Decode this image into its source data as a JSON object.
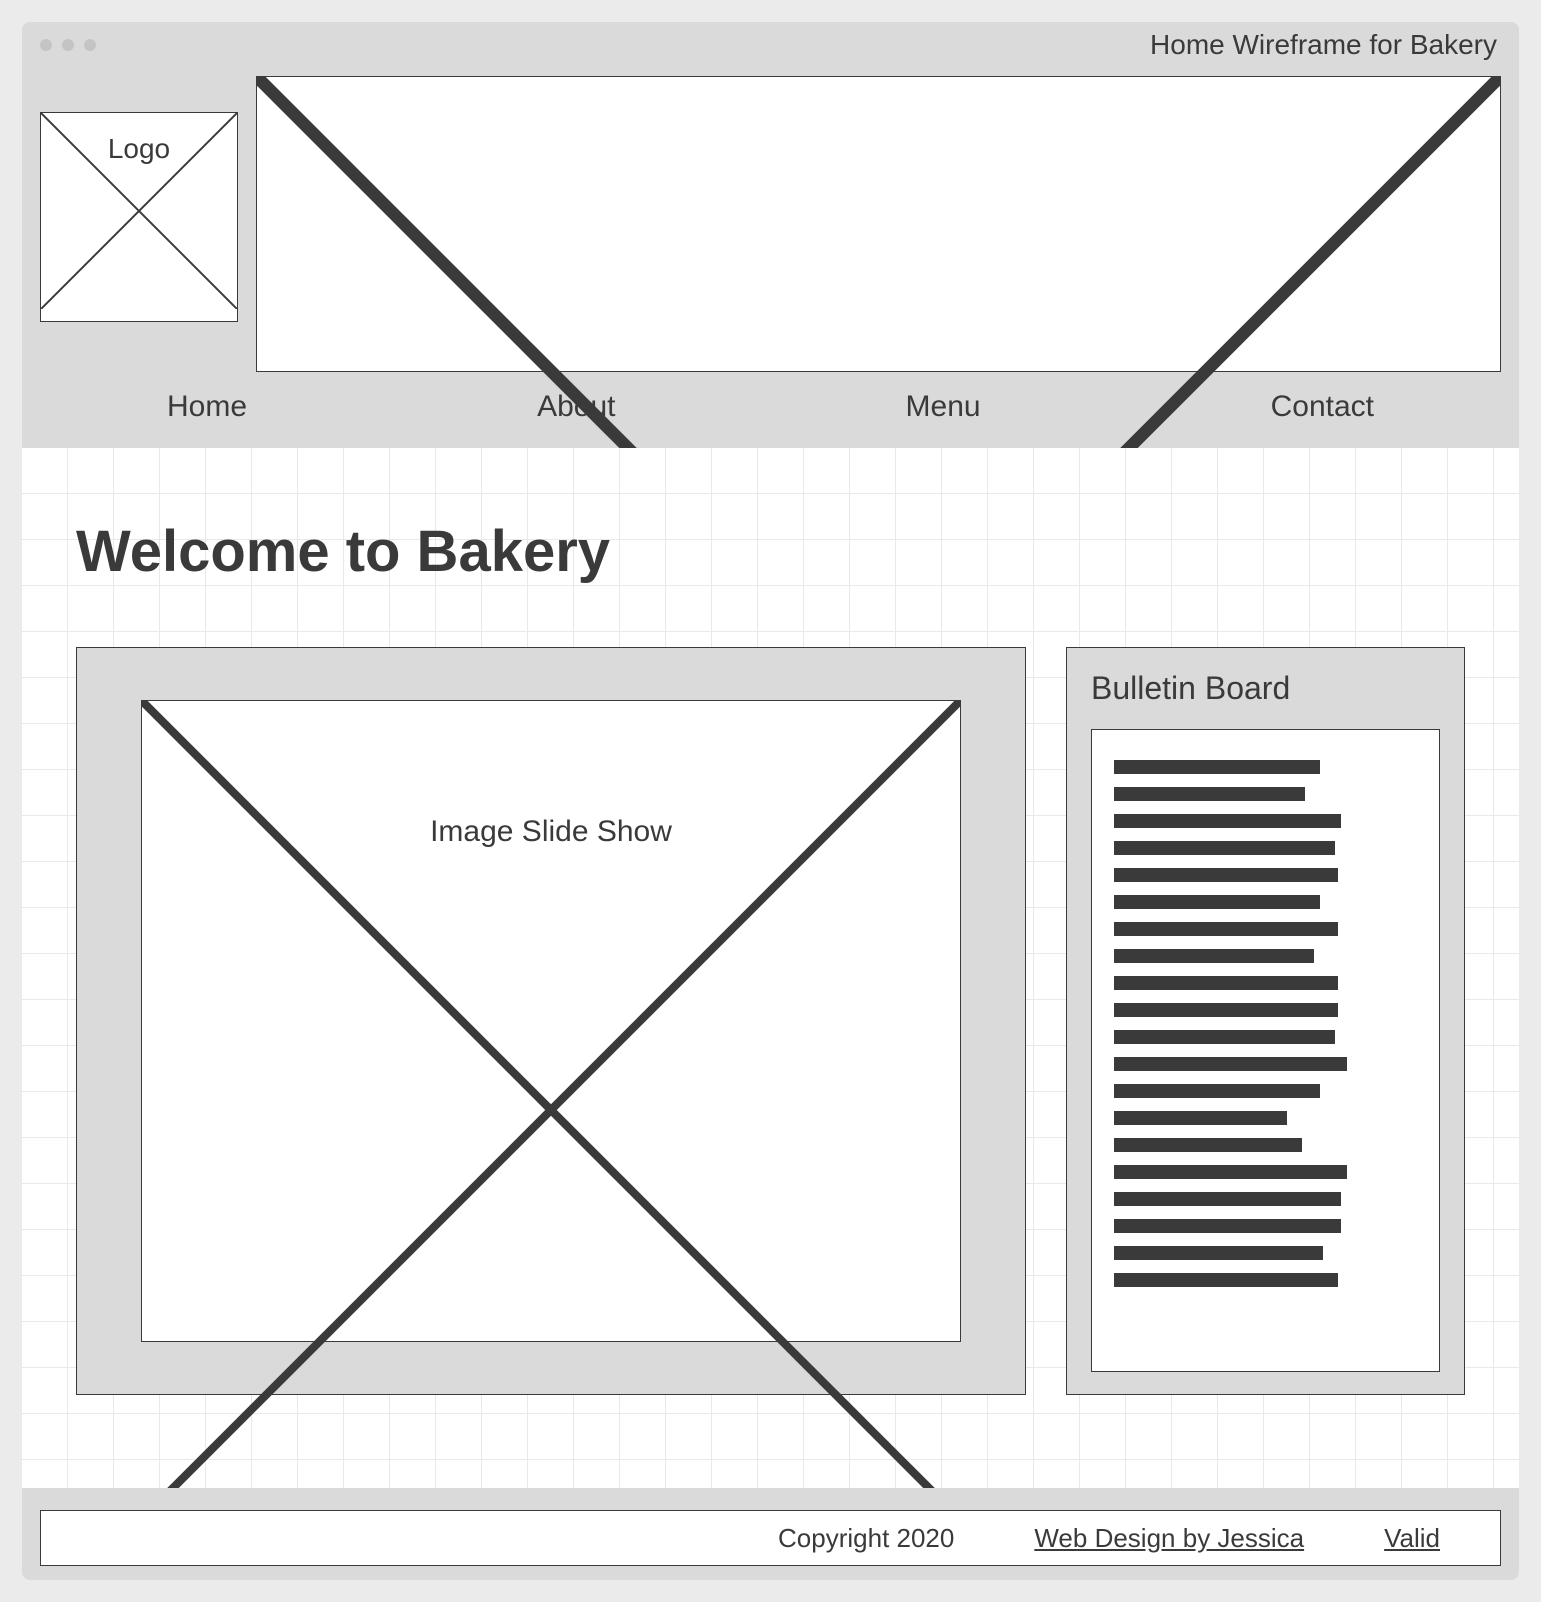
{
  "window": {
    "title": "Home Wireframe for Bakery"
  },
  "header": {
    "logo_label": "Logo",
    "nav": [
      "Home",
      "About",
      "Menu",
      "Contact"
    ]
  },
  "main": {
    "heading": "Welcome to Bakery",
    "slideshow_label": "Image Slide Show",
    "bulletin": {
      "title": "Bulletin Board",
      "line_widths_pct": [
        68,
        63,
        75,
        73,
        74,
        68,
        74,
        66,
        74,
        74,
        73,
        77,
        68,
        57,
        62,
        77,
        75,
        75,
        69,
        74
      ]
    }
  },
  "footer": {
    "copyright": "Copyright 2020",
    "design_link": "Web Design by Jessica",
    "valid_link": "Valid"
  }
}
